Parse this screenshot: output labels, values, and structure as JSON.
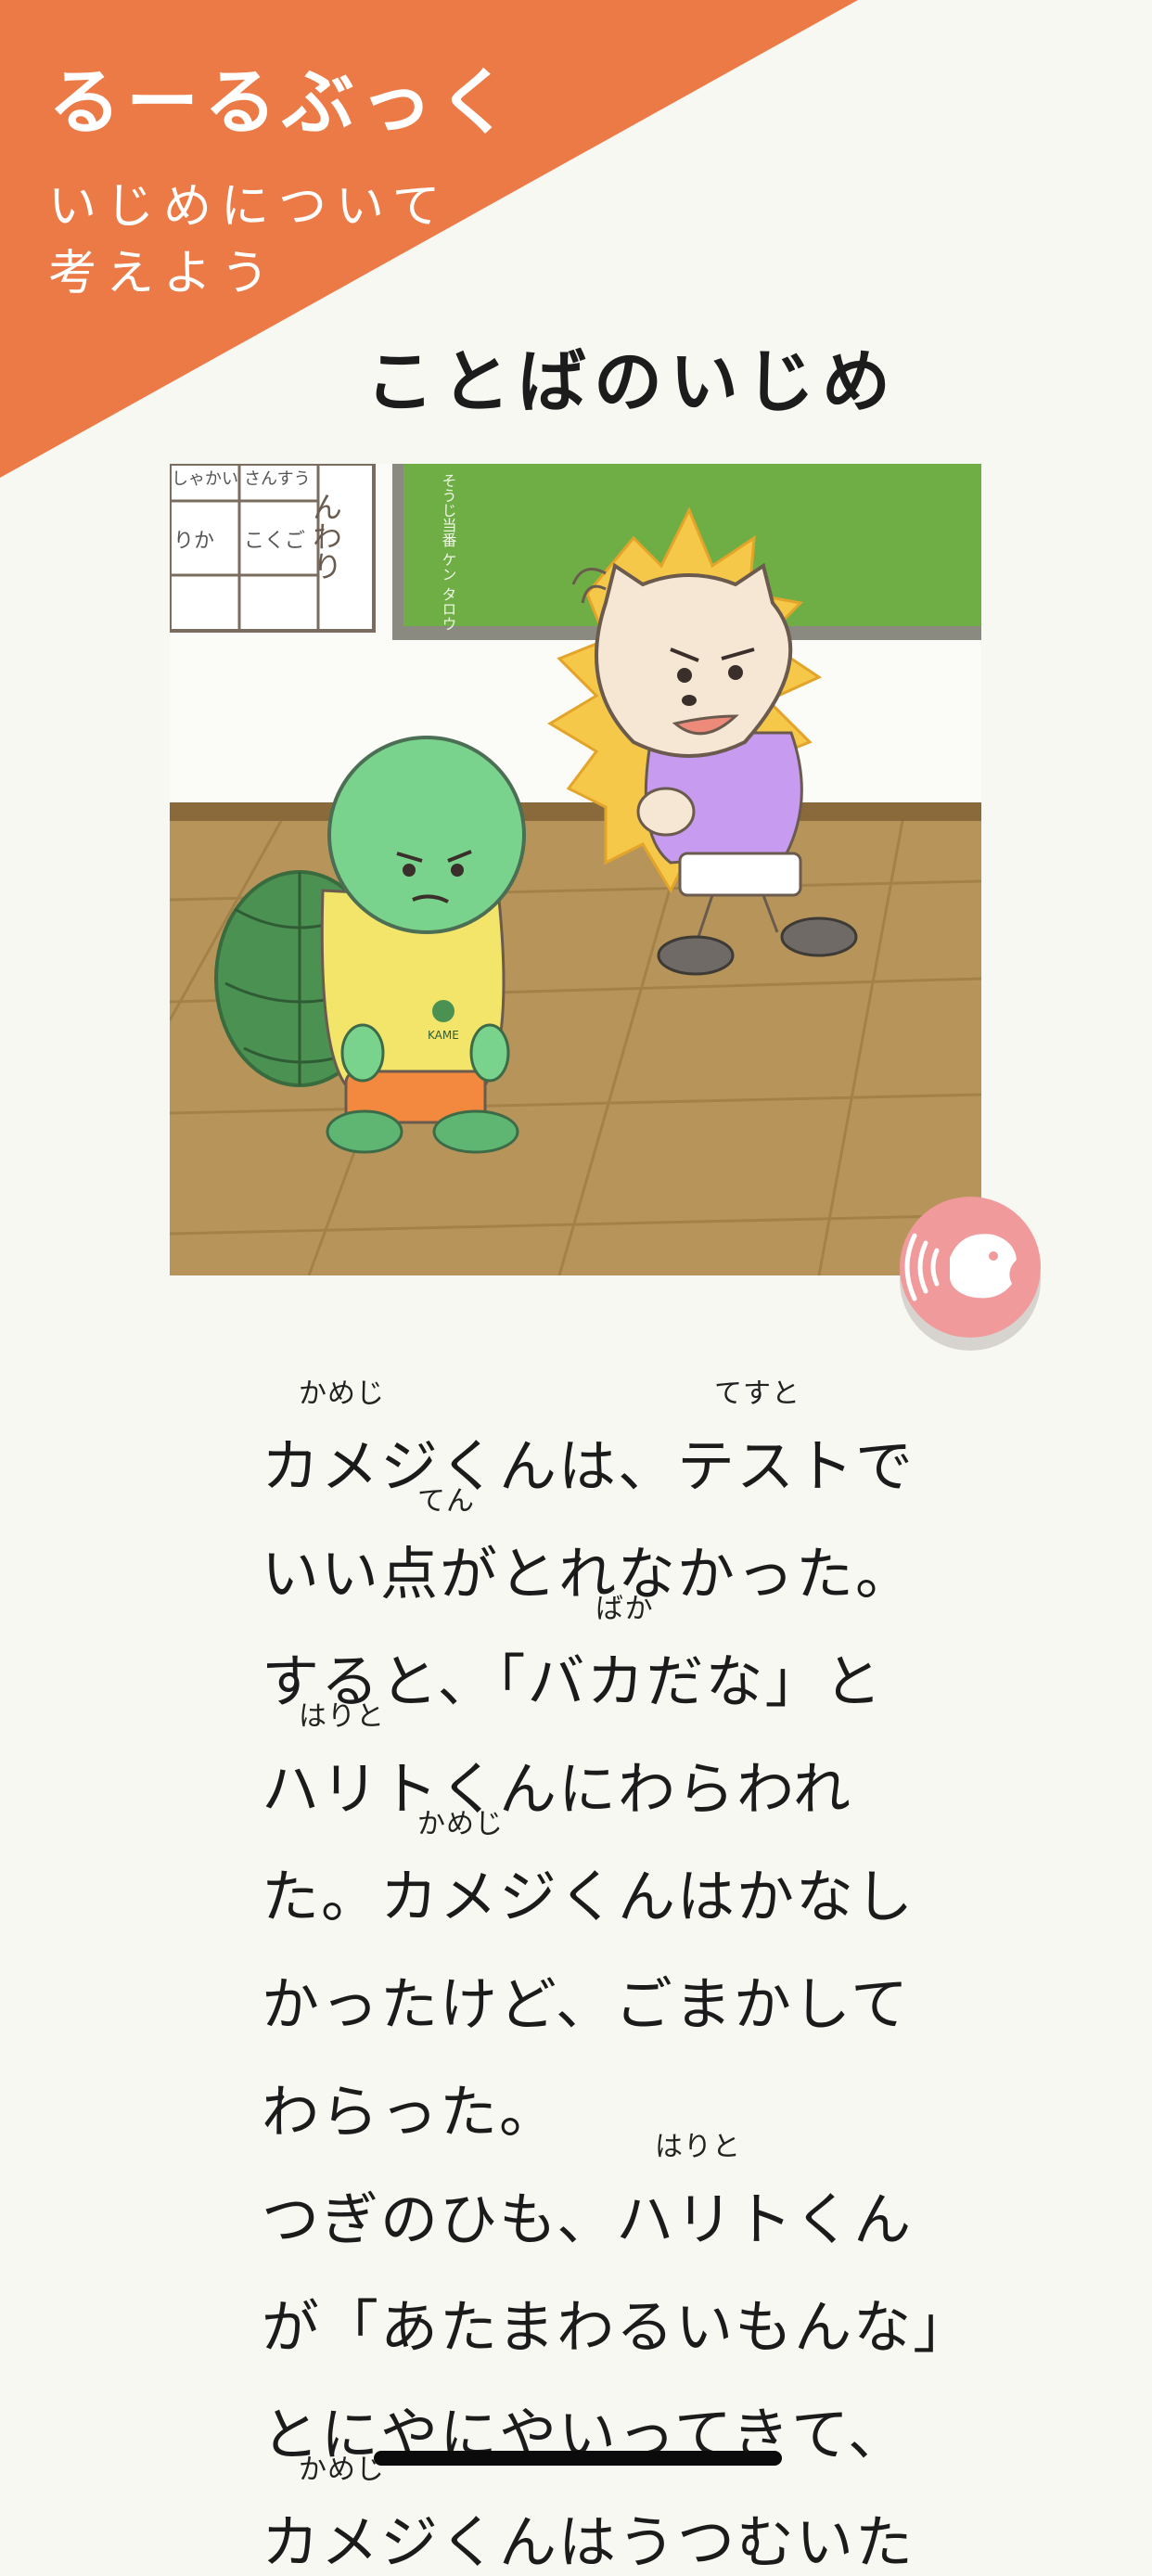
{
  "app": {
    "title": "るーるぶっく",
    "subtitle_line1": "いじめについて",
    "subtitle_line2": "考えよう",
    "accent_color": "#ec7a46",
    "background_color": "#f8f8f3"
  },
  "chapter": {
    "title": "ことばのいじめ"
  },
  "illustration": {
    "icon": "classroom-turtle-hedgehog-illustration",
    "board_chalk_text": "そうじ当番 ケン タロウ",
    "timetable_cells": [
      "しゃかい",
      "さんすう",
      "りか",
      "こくご"
    ],
    "poster_text": "んわり",
    "shirt_text": "KAME"
  },
  "audio_button": {
    "icon": "read-aloud-speaker-icon",
    "color": "#f09a9c"
  },
  "story": {
    "lines": [
      {
        "text": "カメジくんは、テストで",
        "ruby": [
          {
            "text": "かめじ",
            "offset": 0
          },
          {
            "text": "てすと",
            "offset": 7
          }
        ]
      },
      {
        "text": "いい点がとれなかった。",
        "ruby": [
          {
            "text": "てん",
            "offset": 2
          }
        ]
      },
      {
        "text": "すると、「バカだな」と",
        "ruby": [
          {
            "text": "ばか",
            "offset": 5
          }
        ]
      },
      {
        "text": "ハリトくんにわらわれ",
        "ruby": [
          {
            "text": "はりと",
            "offset": 0
          }
        ]
      },
      {
        "text": "た。カメジくんはかなし",
        "ruby": [
          {
            "text": "かめじ",
            "offset": 2
          }
        ]
      },
      {
        "text": "かったけど、ごまかして",
        "ruby": []
      },
      {
        "text": "わらった。",
        "ruby": []
      },
      {
        "text": "つぎのひも、ハリトくん",
        "ruby": [
          {
            "text": "はりと",
            "offset": 6
          }
        ]
      },
      {
        "text": "が「あたまわるいもんな」",
        "ruby": []
      },
      {
        "text": "とにやにやいってきて、",
        "ruby": []
      },
      {
        "text": "カメジくんはうつむいた",
        "ruby": [
          {
            "text": "かめじ",
            "offset": 0
          }
        ]
      }
    ]
  }
}
